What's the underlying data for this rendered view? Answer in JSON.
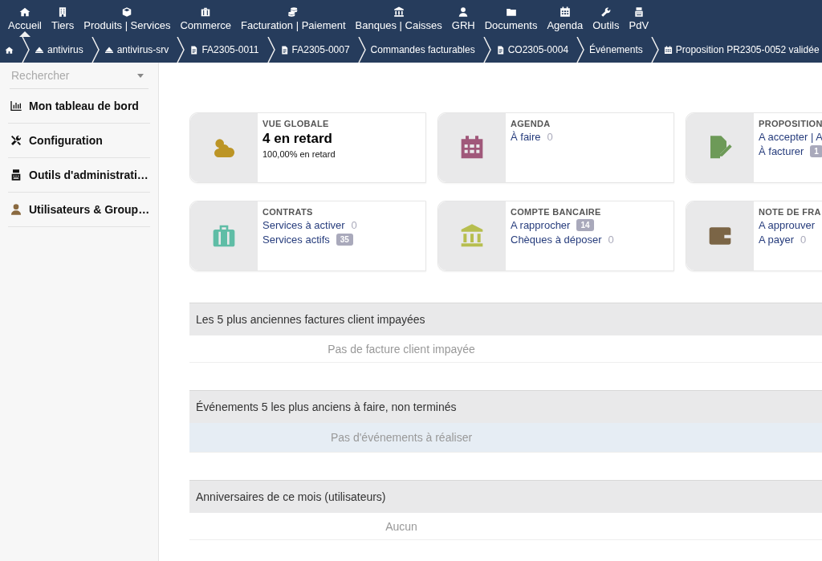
{
  "top_menu": [
    {
      "label": "Accueil",
      "kind": "home",
      "selected": true
    },
    {
      "label": "Tiers",
      "kind": "building",
      "selected": false
    },
    {
      "label": "Produits | Services",
      "kind": "cube",
      "selected": false
    },
    {
      "label": "Commerce",
      "kind": "briefcase",
      "selected": false
    },
    {
      "label": "Facturation | Paiement",
      "kind": "coins",
      "selected": false
    },
    {
      "label": "Banques | Caisses",
      "kind": "bank",
      "selected": false
    },
    {
      "label": "GRH",
      "kind": "user",
      "selected": false
    },
    {
      "label": "Documents",
      "kind": "folder",
      "selected": false
    },
    {
      "label": "Agenda",
      "kind": "calendar",
      "selected": false
    },
    {
      "label": "Outils",
      "kind": "wrench",
      "selected": false
    },
    {
      "label": "PdV",
      "kind": "register",
      "selected": false
    }
  ],
  "breadcrumb": [
    {
      "kind": "home"
    },
    {
      "kind": "server",
      "label": "antivirus"
    },
    {
      "kind": "server",
      "label": "antivirus-srv"
    },
    {
      "kind": "invoice",
      "label": "FA2305-0011"
    },
    {
      "kind": "invoice",
      "label": "FA2305-0007"
    },
    {
      "kind": "text",
      "label": "Commandes facturables"
    },
    {
      "kind": "order",
      "label": "CO2305-0004"
    },
    {
      "kind": "text",
      "label": "Événements"
    },
    {
      "kind": "calendar",
      "label": "Proposition PR2305-0052 validée"
    }
  ],
  "sidebar": {
    "search": {
      "placeholder": "Rechercher"
    },
    "items": [
      {
        "kind": "chart",
        "label": "Mon tableau de bord"
      },
      {
        "kind": "tools",
        "label": "Configuration"
      },
      {
        "kind": "server",
        "label": "Outils d'administrati…"
      },
      {
        "kind": "user",
        "label": "Utilisateurs & Group…"
      }
    ]
  },
  "boxes": [
    {
      "kind": "weather",
      "title": "VUE GLOBALE",
      "headline": "4 en retard",
      "subline": "100,00% en retard"
    },
    {
      "kind": "calendar",
      "title": "AGENDA",
      "lines": [
        {
          "label": "À faire",
          "count": "0"
        }
      ]
    },
    {
      "kind": "proposal",
      "title": "PROPOSITION",
      "lines": [
        {
          "label": "A accepter | A"
        },
        {
          "label": "À facturer",
          "badge": "1"
        }
      ]
    },
    {
      "kind": "suitcase",
      "title": "CONTRATS",
      "lines": [
        {
          "label": "Services à activer",
          "count": "0"
        },
        {
          "label": "Services actifs",
          "badge": "35"
        }
      ]
    },
    {
      "kind": "bank",
      "title": "COMPTE BANCAIRE",
      "lines": [
        {
          "label": "A rapprocher",
          "badge": "14"
        },
        {
          "label": "Chèques à déposer",
          "count": "0"
        }
      ]
    },
    {
      "kind": "wallet",
      "title": "NOTE DE FRA",
      "lines": [
        {
          "label": "A approuver"
        },
        {
          "label": "A payer",
          "count": "0"
        }
      ]
    }
  ],
  "sections": [
    {
      "title": "Les 5 plus anciennes factures client impayées",
      "empty_text": "Pas de facture client impayée",
      "highlighted": false
    },
    {
      "title": "Événements 5 les plus anciens à faire, non terminés",
      "empty_text": "Pas d'événements à réaliser",
      "highlighted": true
    },
    {
      "title": "Anniversaires de ce mois (utilisateurs)",
      "empty_text": "Aucun",
      "highlighted": false
    }
  ]
}
